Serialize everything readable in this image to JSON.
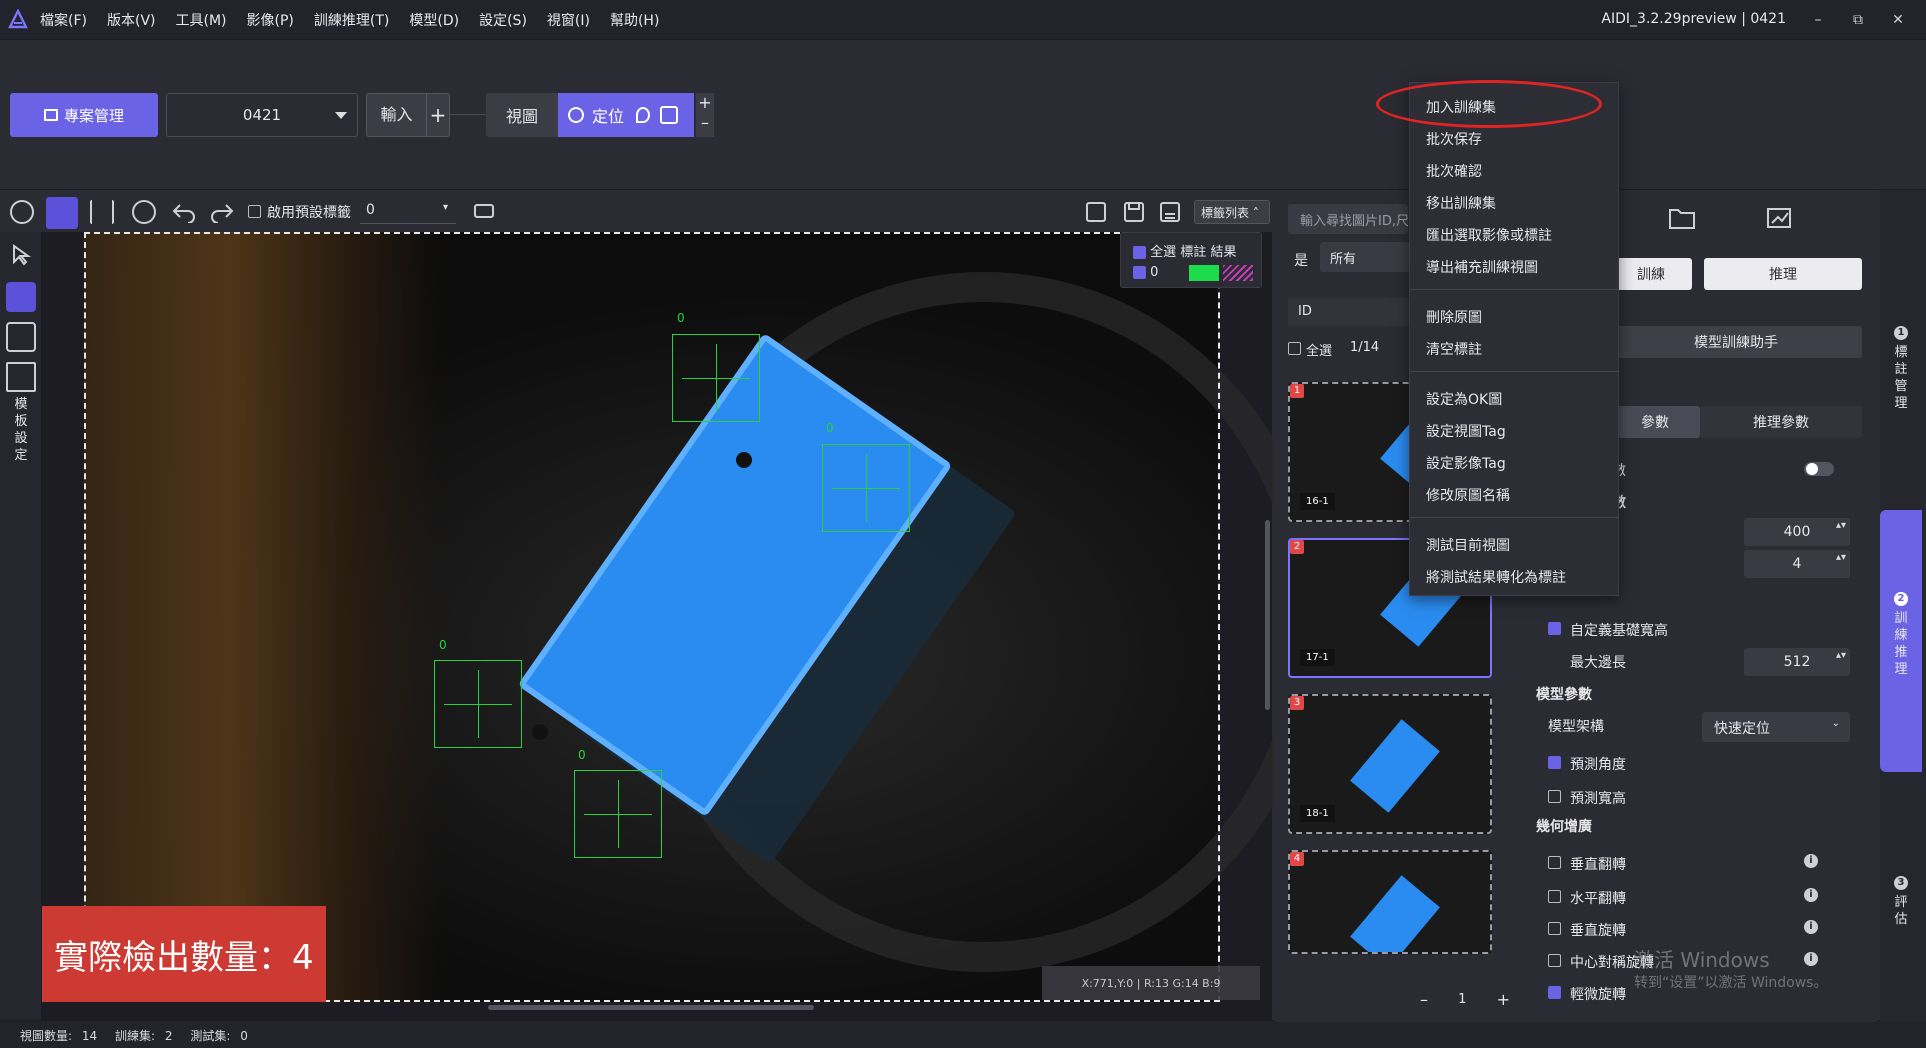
{
  "menu": [
    "檔案(F)",
    "版本(V)",
    "工具(M)",
    "影像(P)",
    "訓練推理(T)",
    "模型(D)",
    "設定(S)",
    "視窗(I)",
    "幫助(H)"
  ],
  "window": {
    "title": "AIDI_3.2.29preview | 0421",
    "min": "–",
    "restore": "⧉",
    "close": "✕"
  },
  "toolbar": {
    "project_btn": "專案管理",
    "project_value": "0421",
    "input_btn": "輸入",
    "plus": "+",
    "view_btn": "視圖",
    "locate_btn": "定位",
    "zoom_in": "+",
    "zoom_out": "–"
  },
  "subbar": {
    "preset_label": "啟用預設標籤",
    "preset_value": "0",
    "label_list": "標籤列表"
  },
  "label_panel": {
    "select_all": "全選",
    "annotate": "標註",
    "result": "結果",
    "label0": "0",
    "swatch_color": "#1ddc4c"
  },
  "left_tools": {
    "template_setting": "模板設定"
  },
  "canvas": {
    "box_label": "0",
    "count_label": "實際檢出數量：4",
    "coords": "X:771,Y:0 | R:13 G:14 B:9"
  },
  "status": {
    "view_count_label": "視圖數量:",
    "view_count": "14",
    "train_label": "訓練集:",
    "train_count": "2",
    "test_label": "測試集:",
    "test_count": "0"
  },
  "mid": {
    "search_placeholder": "輸入尋找圖片ID,尺",
    "filter_yes": "是",
    "filter_all": "所有",
    "id_header": "ID",
    "select_all": "全選",
    "page_count": "1/14",
    "page": "1",
    "minus": "–",
    "plus": "+",
    "thumbs": [
      {
        "num": "1",
        "tag": "16-1"
      },
      {
        "num": "2",
        "tag": "17-1"
      },
      {
        "num": "3",
        "tag": "18-1"
      },
      {
        "num": "4",
        "tag": ""
      }
    ]
  },
  "right": {
    "train_btn": "訓練",
    "infer_btn": "推理",
    "assistant": "模型訓練助手",
    "param_tab": "參數",
    "infer_param_tab": "推理參數",
    "val_400": "400",
    "val_4": "4",
    "custom_size": "自定義基礎寬高",
    "max_edge": "最大邊長",
    "max_edge_value": "512",
    "model_param": "模型參數",
    "model_arch": "模型架構",
    "model_arch_value": "快速定位",
    "predict_angle": "預測角度",
    "predict_wh": "預測寬高",
    "geo_aug": "幾何增廣",
    "flip_v": "垂直翻轉",
    "flip_h": "水平翻轉",
    "rotate_v": "垂直旋轉",
    "center_rotate": "中心對稱旋轉",
    "fine_rotate": "輕微旋轉",
    "num_frag": "數",
    "num_frag2": "數"
  },
  "right_side": {
    "tab1_num": "1",
    "tab1": "標註管理",
    "tab2_num": "2",
    "tab2": "訓練推理",
    "tab3_num": "3",
    "tab3": "評估"
  },
  "context_menu": [
    "加入訓練集",
    "批次保存",
    "批次確認",
    "移出訓練集",
    "匯出選取影像或標註",
    "導出補充訓練視圖",
    "刪除原圖",
    "清空標註",
    "設定為OK圖",
    "設定視圖Tag",
    "設定影像Tag",
    "修改原圖名稱",
    "測試目前視圖",
    "將測試結果轉化為標註"
  ],
  "watermark": {
    "line1": "激活 Windows",
    "line2": "转到“设置”以激活 Windows。"
  }
}
